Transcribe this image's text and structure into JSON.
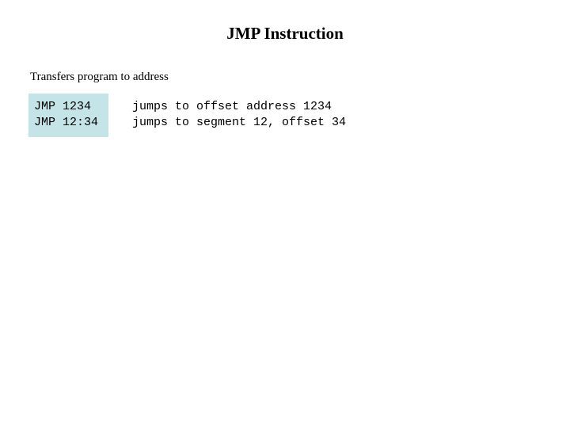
{
  "slide": {
    "title": "JMP Instruction",
    "subtitle": "Transfers program to address",
    "background_color": "#ffffff",
    "text_color": "#000000",
    "highlight_color": "#c5e4e7"
  },
  "code_table": {
    "rows": [
      {
        "instruction": "JMP 1234",
        "description": "jumps to offset address 1234"
      },
      {
        "instruction": "JMP 12:34",
        "description": "jumps to segment 12, offset 34"
      }
    ]
  }
}
